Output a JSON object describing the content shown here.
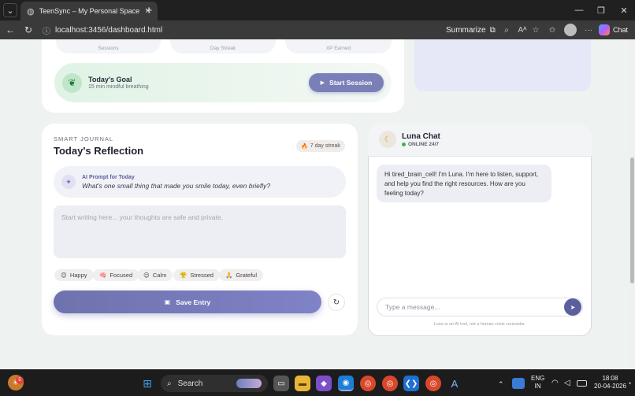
{
  "browser": {
    "tab_title": "TeenSync – My Personal Space",
    "url": "localhost:3456/dashboard.html",
    "summarize_label": "Summarize",
    "chat_label": "Chat"
  },
  "stats": {
    "sessions": "Sessions",
    "day_streak": "Day Streak",
    "xp_earned": "XP Earned"
  },
  "goal": {
    "title": "Today's Goal",
    "subtitle": "15 min mindful breathing",
    "button": "Start Session"
  },
  "journal": {
    "eyebrow": "SMART JOURNAL",
    "title": "Today's Reflection",
    "streak": "7 day streak",
    "prompt_label": "AI Prompt for Today",
    "prompt_text": "What's one small thing that made you smile today, even briefly?",
    "placeholder": "Start writing here... your thoughts are safe and private.",
    "moods": [
      "Happy",
      "Focused",
      "Calm",
      "Stressed",
      "Grateful"
    ],
    "save_label": "Save Entry"
  },
  "chat": {
    "name": "Luna Chat",
    "status": "ONLINE 24/7",
    "message": "Hi tired_brain_cell! I'm Luna. I'm here to listen, support, and help you find the right resources. How are you feeling today?",
    "input_placeholder": "Type a message...",
    "disclaimer": "Luna is an AI tool, not a human crisis counselor."
  },
  "taskbar": {
    "search_label": "Search",
    "notification_count": "5",
    "lang_top": "ENG",
    "lang_bottom": "IN",
    "time": "18:08",
    "date": "20-04-2026"
  },
  "colors": {
    "accent": "#7a7fb8",
    "online": "#3cb35a",
    "page_bg": "#eef2f0"
  }
}
